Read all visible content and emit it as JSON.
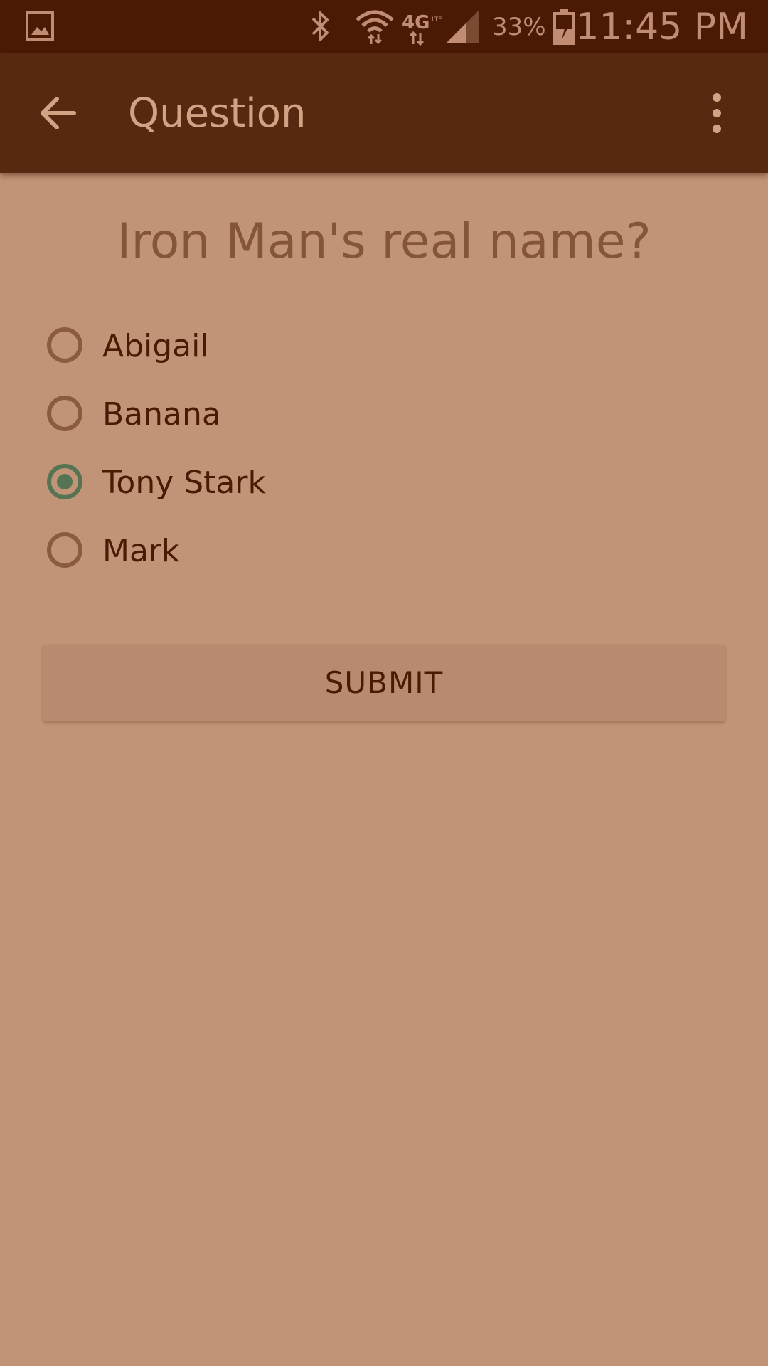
{
  "status_bar": {
    "battery_percent": "33%",
    "time": "11:45 PM",
    "network": "4G LTE",
    "icons": [
      "gallery-icon",
      "bluetooth-icon",
      "wifi-icon",
      "network-4g-icon",
      "signal-icon",
      "battery-charging-icon"
    ]
  },
  "app_bar": {
    "title": "Question",
    "icons": [
      "back-arrow-icon",
      "more-options-icon"
    ]
  },
  "question": "Iron Man's real name?",
  "options": [
    {
      "label": "Abigail",
      "selected": false
    },
    {
      "label": "Banana",
      "selected": false
    },
    {
      "label": "Tony Stark",
      "selected": true
    },
    {
      "label": "Mark",
      "selected": false
    }
  ],
  "submit_label": "SUBMIT",
  "colors": {
    "status_bar_bg": "#4a1a04",
    "app_bar_bg": "#582911",
    "page_bg": "#c29477",
    "accent_selected": "#567453",
    "text_dark": "#4a1a04"
  }
}
